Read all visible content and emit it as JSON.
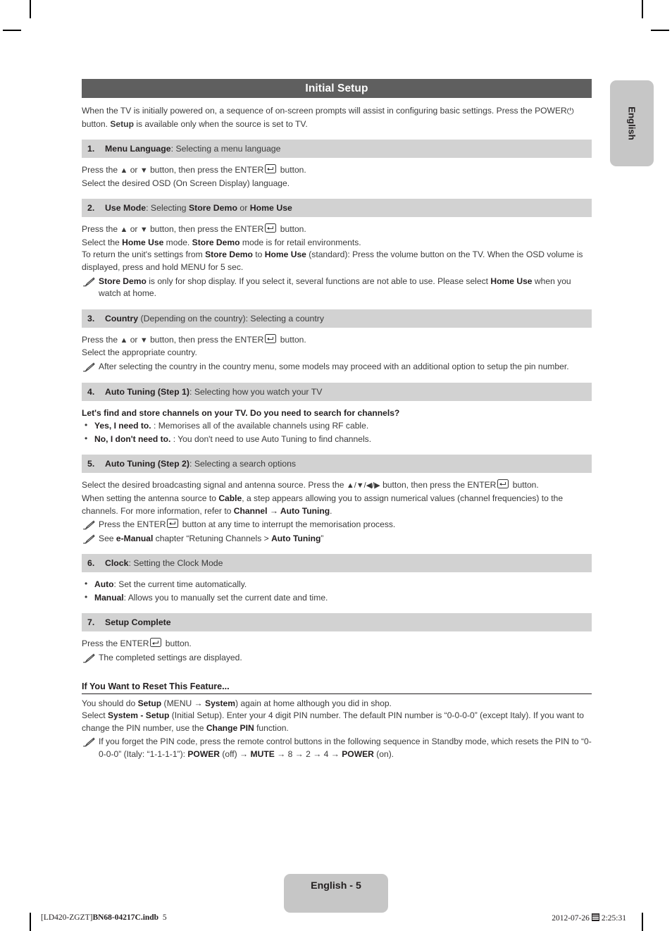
{
  "document": {
    "title": "Initial Setup",
    "language_tab": "English",
    "page_badge": "English - 5"
  },
  "intro": {
    "line1_a": "When the TV is initially powered on, a sequence of on-screen prompts will assist in configuring basic settings. Press the ",
    "power_label": "POWER",
    "power_symbol": "⏻",
    "line2_a": " button. ",
    "setup_label": "Setup",
    "line2_b": " is available only when the source is set to TV."
  },
  "sections": [
    {
      "number": "1.",
      "title": "Menu Language",
      "subtitle": ": Selecting a menu language",
      "body": {
        "l1_a": "Press the ",
        "l1_up": "▲",
        "l1_b": " or ",
        "l1_down": "▼",
        "l1_c": " button, then press the ENTER",
        "l1_d": " button.",
        "l2": "Select the desired OSD (On Screen Display) language."
      }
    },
    {
      "number": "2.",
      "title": "Use Mode",
      "subtitle_a": ": Selecting ",
      "subtitle_b": "Store Demo",
      "subtitle_c": " or ",
      "subtitle_d": "Home Use",
      "body": {
        "l1_a": "Press the ",
        "l1_up": "▲",
        "l1_b": " or ",
        "l1_down": "▼",
        "l1_c": " button, then press the ENTER",
        "l1_d": " button.",
        "l2_a": "Select the ",
        "l2_b": "Home Use",
        "l2_c": " mode. ",
        "l2_d": "Store Demo",
        "l2_e": " mode is for retail environments.",
        "l3_a": "To return the unit's settings from ",
        "l3_b": "Store Demo",
        "l3_c": " to ",
        "l3_d": "Home Use",
        "l3_e": " (standard): Press the volume button on the TV. When the OSD volume is displayed, press and hold MENU for 5 sec.",
        "note_a": "Store Demo",
        "note_b": " is only for shop display. If you select it, several functions are not able to use. Please select ",
        "note_c": "Home Use",
        "note_d": " when you watch at home."
      }
    },
    {
      "number": "3.",
      "title": "Country",
      "subtitle": " (Depending on the country): Selecting a country",
      "body": {
        "l1_a": "Press the ",
        "l1_up": "▲",
        "l1_b": " or ",
        "l1_down": "▼",
        "l1_c": " button, then press the ENTER",
        "l1_d": " button.",
        "l2": "Select the appropriate country.",
        "note": "After selecting the country in the country menu, some models may proceed with an additional option to setup the pin number."
      }
    },
    {
      "number": "4.",
      "title": "Auto Tuning (Step 1)",
      "subtitle": ": Selecting how you watch your TV",
      "body": {
        "heading": "Let's find and store channels on your TV. Do you need to search for channels?",
        "bullet1_b": "Yes, I need to.",
        "bullet1_t": " : Memorises all of the available channels using RF cable.",
        "bullet2_b": "No, I don't need to.",
        "bullet2_t": " : You don't need to use Auto Tuning to find channels."
      }
    },
    {
      "number": "5.",
      "title": "Auto Tuning (Step 2)",
      "subtitle": ": Selecting a search options",
      "body": {
        "l1_a": "Select the desired broadcasting signal and antenna source. Press the ",
        "l1_arrows": "▲/▼/◀/▶",
        "l1_b": " button, then press the ENTER",
        "l1_c": " button.",
        "l2_a": "When setting the antenna source to ",
        "l2_b": "Cable",
        "l2_c": ", a step appears allowing you to assign numerical values (channel frequencies) to the channels. For more information, refer to ",
        "l2_d": "Channel → Auto Tuning",
        "l2_e": ".",
        "note1_a": "Press the ENTER",
        "note1_b": " button at any time to interrupt the memorisation process.",
        "note2_a": "See ",
        "note2_b": "e-Manual",
        "note2_c": " chapter “Retuning Channels > ",
        "note2_d": "Auto Tuning",
        "note2_e": "”"
      }
    },
    {
      "number": "6.",
      "title": "Clock",
      "subtitle": ": Setting the Clock Mode",
      "body": {
        "bullet1_b": "Auto",
        "bullet1_t": ": Set the current time automatically.",
        "bullet2_b": "Manual",
        "bullet2_t": ": Allows you to manually set the current date and time."
      }
    },
    {
      "number": "7.",
      "title": "Setup Complete",
      "subtitle": "",
      "body": {
        "l1_a": "Press the ENTER",
        "l1_b": " button.",
        "note": "The completed settings are displayed."
      }
    }
  ],
  "reset": {
    "heading": "If You Want to Reset This Feature...",
    "l1_a": "You should do ",
    "l1_b": "Setup",
    "l1_c": " (MENU → ",
    "l1_d": "System",
    "l1_e": ") again at home although you did in shop.",
    "l2_a": "Select ",
    "l2_b": "System - Setup",
    "l2_c": " (Initial Setup). Enter your 4 digit PIN number. The default PIN number is “0-0-0-0” (except Italy). If you want to change the PIN number, use the ",
    "l2_d": "Change PIN",
    "l2_e": " function.",
    "note_a": "If you forget the PIN code, press the remote control buttons in the following sequence in Standby mode, which resets the PIN to “0-0-0-0” (Italy: “1-1-1-1”): ",
    "note_b": "POWER",
    "note_c": " (off) → ",
    "note_d": "MUTE",
    "note_e": " → 8 → 2 → 4 → ",
    "note_f": "POWER",
    "note_g": " (on)."
  },
  "footer": {
    "left_bracket": "[LD420-ZGZT]",
    "left_file": "BN68-04217C.indb",
    "left_page": "5",
    "right_date": "2012-07-26",
    "right_time": "2:25:31"
  },
  "colors": {
    "title_bar": "#5f5f5f",
    "section_bar": "#d2d2d2",
    "tab": "#c6c6c6",
    "text": "#3a3a3a"
  }
}
